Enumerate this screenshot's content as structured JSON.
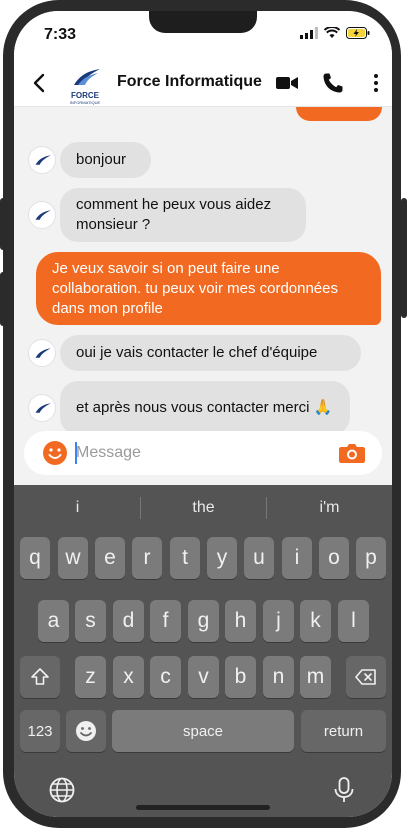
{
  "status_bar": {
    "time": "7:33"
  },
  "header": {
    "title": "Force Informatique",
    "logo_text": "FORCE",
    "logo_subtext": "INFORMATIQUE"
  },
  "messages": [
    {
      "direction": "incoming",
      "text": "bonjour"
    },
    {
      "direction": "incoming",
      "text": "comment he peux vous aidez monsieur ?"
    },
    {
      "direction": "outgoing",
      "text": "Je veux savoir si on peut faire une collaboration. tu peux voir mes cordonnées dans mon profile"
    },
    {
      "direction": "incoming",
      "text": "oui je vais contacter le chef d'équipe"
    },
    {
      "direction": "incoming",
      "text": "et après nous vous contacter merci 🙏"
    }
  ],
  "input": {
    "placeholder": "Message",
    "value": ""
  },
  "keyboard": {
    "suggestions": [
      "i",
      "the",
      "i'm"
    ],
    "row1": [
      "q",
      "w",
      "e",
      "r",
      "t",
      "y",
      "u",
      "i",
      "o",
      "p"
    ],
    "row2": [
      "a",
      "s",
      "d",
      "f",
      "g",
      "h",
      "j",
      "k",
      "l"
    ],
    "row3": [
      "z",
      "x",
      "c",
      "v",
      "b",
      "n",
      "m"
    ],
    "numbers_label": "123",
    "space_label": "space",
    "return_label": "return"
  },
  "colors": {
    "accent": "#f26a21",
    "incoming_bubble": "#e1e1e1",
    "keyboard_bg": "#545454",
    "key_bg": "#7b7b7b"
  },
  "icons": {
    "back": "chevron-left-icon",
    "video": "video-camera-icon",
    "call": "phone-icon",
    "more": "vertical-dots-icon",
    "emoji": "smiley-icon",
    "camera": "camera-icon",
    "shift": "shift-arrow-icon",
    "backspace": "backspace-icon",
    "globe": "globe-icon",
    "mic": "microphone-icon"
  }
}
